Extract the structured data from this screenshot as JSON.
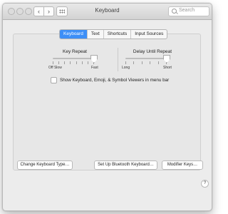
{
  "window": {
    "title": "Keyboard"
  },
  "toolbar": {
    "back_icon": "chevron-left-icon",
    "forward_icon": "chevron-right-icon",
    "grid_icon": "grid-icon",
    "back_glyph": "‹",
    "forward_glyph": "›",
    "search_placeholder": "Search"
  },
  "tabs": [
    {
      "label": "Keyboard",
      "active": true
    },
    {
      "label": "Text",
      "active": false
    },
    {
      "label": "Shortcuts",
      "active": false
    },
    {
      "label": "Input Sources",
      "active": false
    }
  ],
  "key_repeat": {
    "title": "Key Repeat",
    "left_label": "Off Slow",
    "right_label": "Fast",
    "ticks": 8,
    "value_fraction": 1.0
  },
  "delay_until_repeat": {
    "title": "Delay Until Repeat",
    "left_label": "Long",
    "right_label": "Short",
    "ticks": 6,
    "value_fraction": 1.0
  },
  "checkbox": {
    "label": "Show Keyboard, Emoji, & Symbol Viewers in menu bar",
    "checked": false
  },
  "buttons": {
    "change_type": "Change Keyboard Type…",
    "bluetooth": "Set Up Bluetooth Keyboard…",
    "modifier": "Modifier Keys…"
  },
  "help": {
    "glyph": "?"
  },
  "colors": {
    "accent": "#3d8ff7"
  }
}
